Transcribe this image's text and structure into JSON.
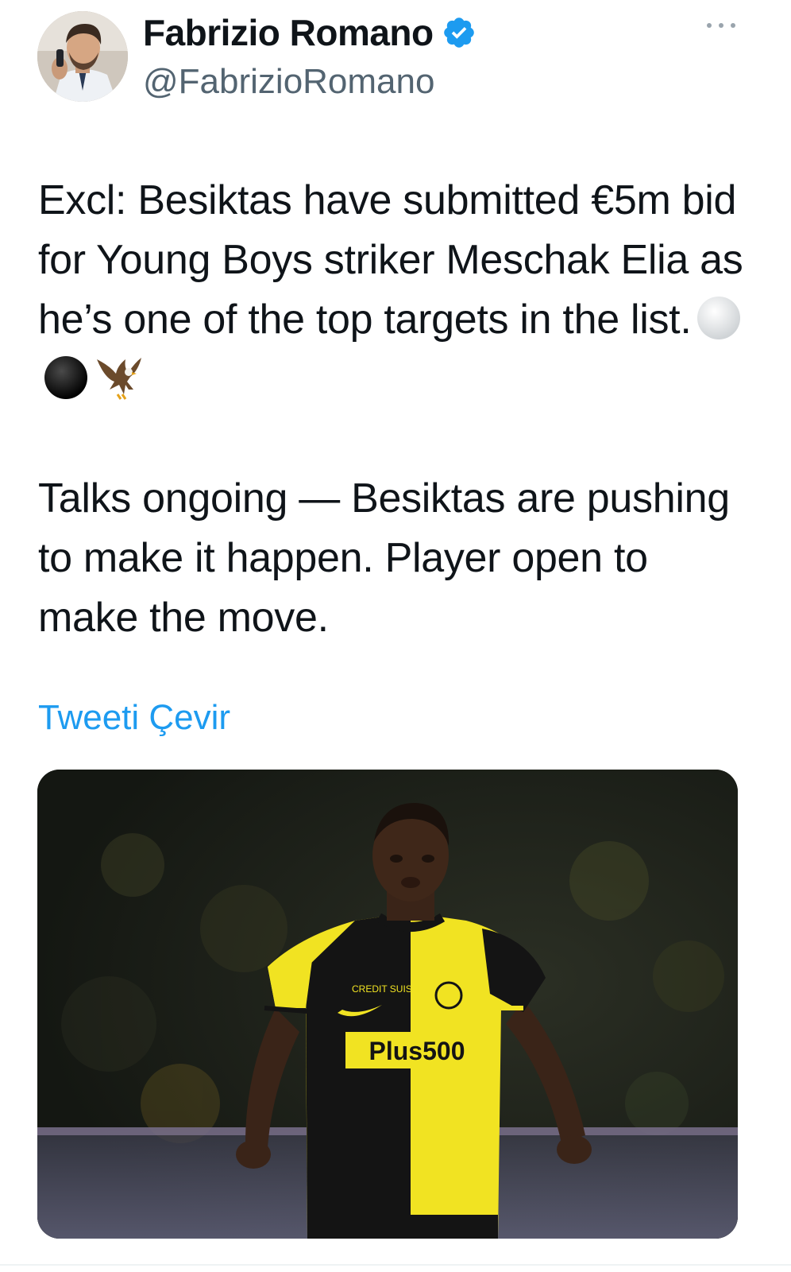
{
  "author": {
    "display_name": "Fabrizio Romano",
    "handle": "@FabrizioRomano",
    "verified": true,
    "verified_color": "#1d9bf0"
  },
  "tweet": {
    "paragraph_1": "Excl: Besiktas have submitted €5m bid for Young Boys striker Meschak Elia as he’s one of the top targets in the list.",
    "emojis": [
      "white-circle-icon",
      "black-circle-icon",
      "eagle-icon"
    ],
    "paragraph_2": "Talks ongoing — Besiktas are pushing to make it happen. Player open to make the move.",
    "translate_label": "Tweeti Çevir"
  },
  "media": {
    "jersey_sponsor": "Plus500",
    "jersey_secondary": "CREDIT SUISSE"
  },
  "colors": {
    "text": "#0f1419",
    "secondary": "#536471",
    "link": "#1d9bf0"
  }
}
